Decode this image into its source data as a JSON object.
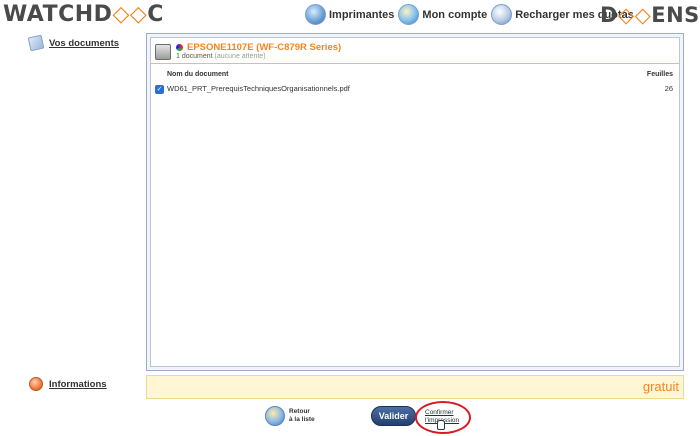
{
  "header": {
    "logo_left": {
      "part1": "WATCHD",
      "accent": "◇◇",
      "part2": "C"
    },
    "logo_right": {
      "part1": "D",
      "accent": "◇◇",
      "part2": "ENSE"
    },
    "nav": {
      "printers_label": "Imprimantes",
      "account_label": "Mon compte",
      "reload_label": "Recharger mes quotas"
    }
  },
  "sidebar": {
    "documents_label": "Vos documents",
    "information_label": "Informations"
  },
  "printer": {
    "name": "EPSONE1107E (WF-C879R Series)",
    "count": "1 document",
    "status": "(aucune attente)"
  },
  "table": {
    "headers": {
      "document": "Nom du document",
      "pages": "Feuilles"
    },
    "rows": [
      {
        "name": "WD61_PRT_PrerequisTechniquesOrganisationnels.pdf",
        "pages": "26",
        "checked": true
      }
    ]
  },
  "price": "gratuit",
  "actions": {
    "back_line1": "Retour",
    "back_line2": "à la liste",
    "validate_label": "Valider",
    "confirm_line1": "Confirmer",
    "confirm_line2": "l'impression"
  },
  "colors": {
    "accent": "#f5841f",
    "highlight_ring": "#d51d24",
    "button": "#22406d"
  }
}
